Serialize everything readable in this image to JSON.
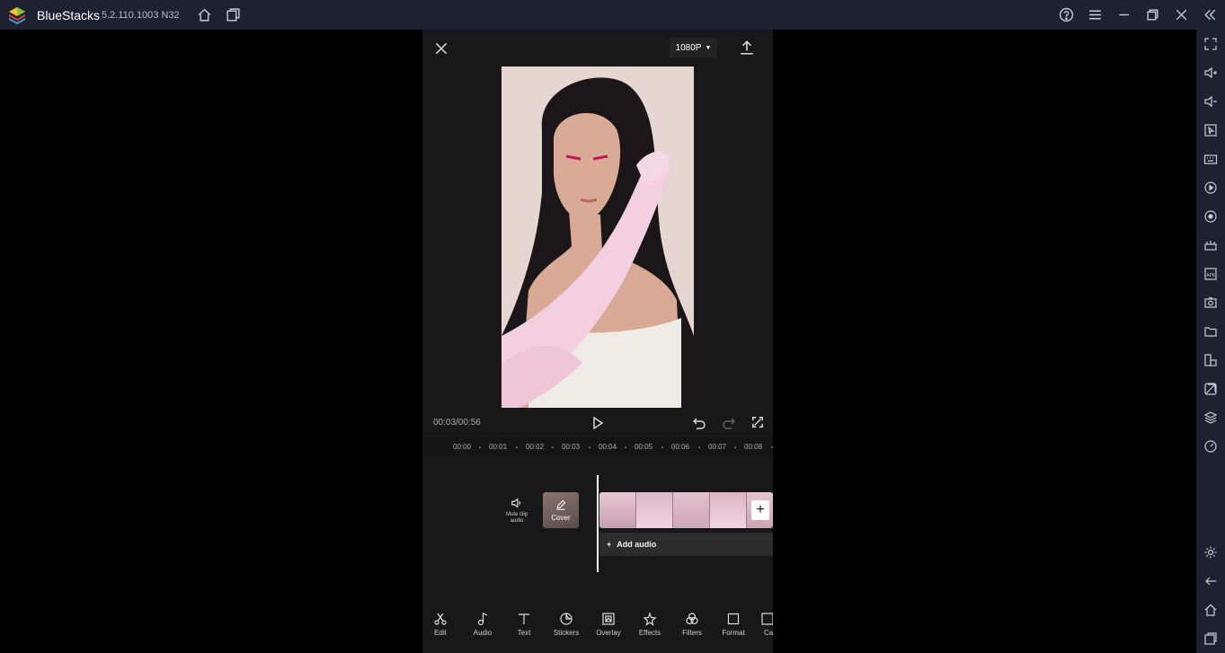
{
  "titlebar": {
    "app_name": "BlueStacks",
    "version": "5.2.110.1003 N32"
  },
  "editor": {
    "resolution": "1080P",
    "time": "00:03/00:56",
    "ruler_ticks": [
      "00:00",
      "00:01",
      "00:02",
      "00:03",
      "00:04",
      "00:05",
      "00:06",
      "00:07",
      "00:08"
    ],
    "mute_label": "Mute clip audio",
    "cover_label": "Cover",
    "add_audio_label": "Add audio",
    "tools": [
      {
        "label": "Edit",
        "icon": "scissors-icon"
      },
      {
        "label": "Audio",
        "icon": "music-note-icon"
      },
      {
        "label": "Text",
        "icon": "text-icon"
      },
      {
        "label": "Stickers",
        "icon": "sticker-icon"
      },
      {
        "label": "Overlay",
        "icon": "overlay-icon"
      },
      {
        "label": "Effects",
        "icon": "effects-icon"
      },
      {
        "label": "Filters",
        "icon": "filters-icon"
      },
      {
        "label": "Format",
        "icon": "format-icon"
      },
      {
        "label": "Ca",
        "icon": "canvas-icon"
      }
    ]
  },
  "colors": {
    "titlebar_bg": "#1e2130",
    "editor_bg": "#181818",
    "accent_pink": "#f2c7d8"
  }
}
